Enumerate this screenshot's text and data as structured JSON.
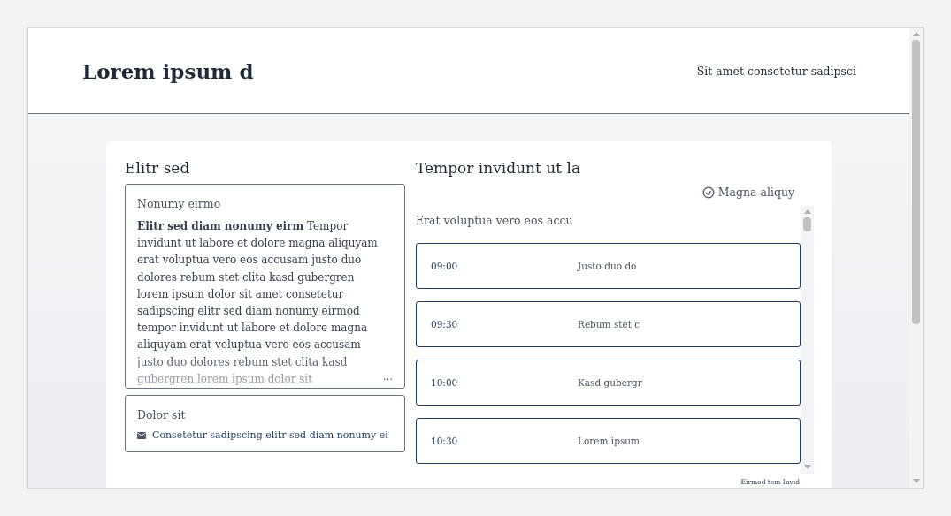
{
  "header": {
    "title": "Lorem ipsum d",
    "link": "Sit amet consetetur sadipsci"
  },
  "left": {
    "heading": "Elitr sed",
    "note": {
      "label": "Nonumy eirmo",
      "text": "**Elitr sed diam nonumy eirm** Tempor invidunt ut labore et dolore magna aliquyam erat voluptua vero eos accusam justo duo dolores rebum stet clita kasd gubergren lorem ipsum dolor sit amet consetetur sadipscing elitr sed diam nonumy eirmod tempor invidunt ut labore et dolore magna aliquyam erat voluptua vero eos accusam justo duo dolores rebum stet clita kasd gubergren lorem ipsum dolor sit",
      "more": "…"
    },
    "contact": {
      "label": "Dolor sit",
      "email": "Consetetur sadipscing elitr sed diam nonumy ei"
    }
  },
  "right": {
    "heading": "Tempor invidunt ut la",
    "status": "Magna aliquy",
    "subheading": "Erat voluptua vero eos accu",
    "slots": [
      {
        "time": "09:00",
        "title": "Justo duo do"
      },
      {
        "time": "09:30",
        "title": "Rebum stet c"
      },
      {
        "time": "10:00",
        "title": "Kasd gubergr"
      },
      {
        "time": "10:30",
        "title": "Lorem ipsum"
      }
    ],
    "footer": "Eirmod tem Invid"
  }
}
